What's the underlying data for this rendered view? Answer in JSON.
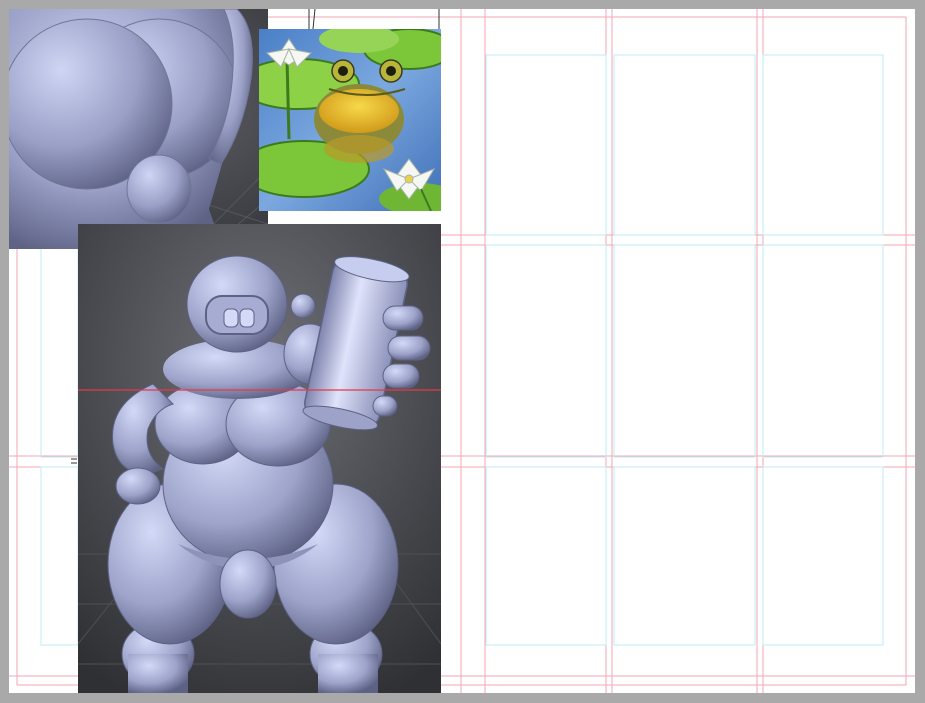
{
  "canvas": {
    "background": "#a9a9a9",
    "page_color": "#ffffff",
    "bleed_guide_color": "#f3a6b5",
    "safe_guide_color": "#bdeef3",
    "selection_line_color": "#e23a4a"
  },
  "panels": [
    {
      "name": "top-left-panel",
      "description_icon": "3d-render-figure"
    },
    {
      "name": "frog-lily-pad-panel",
      "description_icon": "frog-painting"
    },
    {
      "name": "main-figure-panel",
      "description_icon": "3d-figure-holding-can"
    }
  ]
}
